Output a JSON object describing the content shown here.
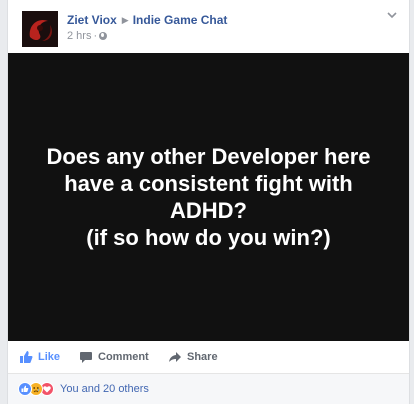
{
  "post": {
    "author": "Ziet Viox",
    "group": "Indie Game Chat",
    "time": "2 hrs",
    "separator": "·",
    "image_text": "Does any other Developer here have a consistent fight with ADHD?\n(if so how do you win?)"
  },
  "actions": {
    "like_label": "Like",
    "comment_label": "Comment",
    "share_label": "Share"
  },
  "reactions": {
    "summary": "You and 20 others",
    "icons": [
      "like-icon",
      "sad-icon",
      "love-icon"
    ]
  },
  "colors": {
    "link_blue": "#365899",
    "like_blue": "#5890ff",
    "muted_gray": "#90949c",
    "image_background": "#111111"
  }
}
